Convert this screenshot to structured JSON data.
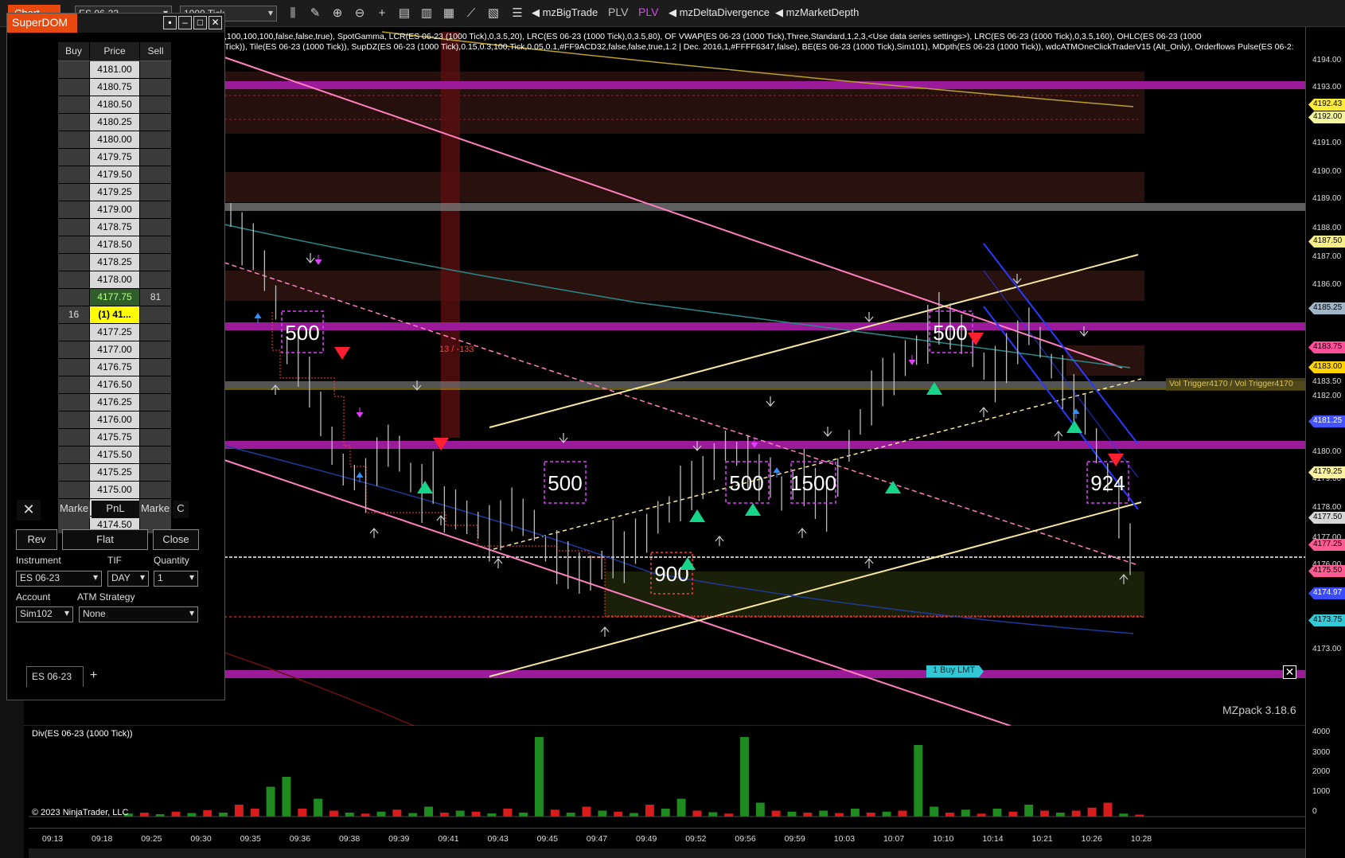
{
  "toolbar": {
    "tab_label": "Chart",
    "instrument": "ES 06-23",
    "interval": "1000 Tick",
    "items": [
      {
        "label": "◀ mzBigTrade"
      },
      {
        "label": "PLV"
      },
      {
        "label": "PLV"
      },
      {
        "label": "◀ mzDeltaDivergence"
      },
      {
        "label": "◀ mzMarketDepth"
      }
    ]
  },
  "chart": {
    "indicator_line1": ",100,100,100,false,false,true), SpotGamma, LCR(ES 06-23 (1000 Tick),0,3.5,20), LRC(ES 06-23 (1000 Tick),0,3.5,80), OF VWAP(ES 06-23 (1000 Tick),Three,Standard,1,2,3,<Use data series settings>), LRC(ES 06-23 (1000 Tick),0,3.5,160), OHLC(ES 06-23 (1000",
    "indicator_line2": "Tick)), Tile(ES 06-23 (1000 Tick)), SupDZ(ES 06-23 (1000 Tick),0.15,0.3,100,Tick,0.05,0.1,#FF9ACD32,false,false,true,1.2 | Dec. 2016,1,#FFFF6347,false), BE(ES 06-23 (1000 Tick),Sim101), MDpth(ES 06-23 (1000 Tick)), wdcATMOneClickTraderV15 (Alt_Only),  Orderflows Pulse(ES 06-2:",
    "vol_trigger": "Vol Trigger4170 / Vol Trigger4170",
    "order_label": "1  Buy LMT",
    "watermark": "MZpack 3.18.6",
    "bigtrade_labels": [
      "500",
      "500",
      "500",
      "500",
      "1500",
      "900",
      "500",
      "924"
    ],
    "delta_label": "13 / -133",
    "div_panel_title": "Div(ES 06-23 (1000 Tick))",
    "copyright": "© 2023 NinjaTrader, LLC"
  },
  "price_axis": {
    "ticks": [
      "4194.00",
      "4193.00",
      "4191.00",
      "4190.00",
      "4189.00",
      "4188.00",
      "4187.00",
      "4186.00",
      "4185.00",
      "4184.00",
      "4183.50",
      "4182.00",
      "4181.00",
      "4180.00",
      "4179.00",
      "4178.00",
      "4177.00",
      "4176.00",
      "4175.00",
      "4174.00",
      "4173.00"
    ],
    "markers": [
      {
        "label": "4192.43",
        "color": "#ffeb3b"
      },
      {
        "label": "4192.00",
        "color": "#f5f5a0"
      },
      {
        "label": "4187.50",
        "color": "#f7f08a"
      },
      {
        "label": "4185.25",
        "color": "#9fb6c9"
      },
      {
        "label": "4183.75",
        "color": "#ff4f9a"
      },
      {
        "label": "4183.00",
        "color": "#ffd400"
      },
      {
        "label": "4181.25",
        "color": "#4455ff"
      },
      {
        "label": "4179.25",
        "color": "#fff2a0"
      },
      {
        "label": "4177.50",
        "color": "#d6d6d6"
      },
      {
        "label": "4177.25",
        "color": "#ff5c93"
      },
      {
        "label": "4175.50",
        "color": "#ff5c93"
      },
      {
        "label": "4174.97",
        "color": "#3b4cff"
      },
      {
        "label": "4173.75",
        "color": "#35c9d8"
      }
    ],
    "volume_ticks": [
      "4000",
      "3000",
      "2000",
      "1000",
      "0"
    ]
  },
  "time_axis": [
    "09:13",
    "09:18",
    "09:25",
    "09:30",
    "09:35",
    "09:36",
    "09:38",
    "09:39",
    "09:41",
    "09:43",
    "09:45",
    "09:47",
    "09:49",
    "09:52",
    "09:56",
    "09:59",
    "10:03",
    "10:07",
    "10:10",
    "10:14",
    "10:21",
    "10:26",
    "10:28"
  ],
  "superdom": {
    "title": "SuperDOM",
    "headers": {
      "buy": "Buy",
      "price": "Price",
      "sell": "Sell"
    },
    "rows": [
      {
        "buy": "",
        "price": "4181.00",
        "sell": ""
      },
      {
        "buy": "",
        "price": "4180.75",
        "sell": ""
      },
      {
        "buy": "",
        "price": "4180.50",
        "sell": ""
      },
      {
        "buy": "",
        "price": "4180.25",
        "sell": ""
      },
      {
        "buy": "",
        "price": "4180.00",
        "sell": ""
      },
      {
        "buy": "",
        "price": "4179.75",
        "sell": ""
      },
      {
        "buy": "",
        "price": "4179.50",
        "sell": ""
      },
      {
        "buy": "",
        "price": "4179.25",
        "sell": ""
      },
      {
        "buy": "",
        "price": "4179.00",
        "sell": ""
      },
      {
        "buy": "",
        "price": "4178.75",
        "sell": ""
      },
      {
        "buy": "",
        "price": "4178.50",
        "sell": ""
      },
      {
        "buy": "",
        "price": "4178.25",
        "sell": ""
      },
      {
        "buy": "",
        "price": "4178.00",
        "sell": ""
      },
      {
        "buy": "",
        "price": "4177.75",
        "sell": "81"
      },
      {
        "buy": "16",
        "price": "(1) 41...",
        "sell": ""
      },
      {
        "buy": "",
        "price": "4177.25",
        "sell": ""
      },
      {
        "buy": "",
        "price": "4177.00",
        "sell": ""
      },
      {
        "buy": "",
        "price": "4176.75",
        "sell": ""
      },
      {
        "buy": "",
        "price": "4176.50",
        "sell": ""
      },
      {
        "buy": "",
        "price": "4176.25",
        "sell": ""
      },
      {
        "buy": "",
        "price": "4176.00",
        "sell": ""
      },
      {
        "buy": "",
        "price": "4175.75",
        "sell": ""
      },
      {
        "buy": "",
        "price": "4175.50",
        "sell": ""
      },
      {
        "buy": "",
        "price": "4175.25",
        "sell": ""
      },
      {
        "buy": "",
        "price": "4175.00",
        "sell": ""
      },
      {
        "buy": "",
        "price": "4174.75",
        "sell": ""
      },
      {
        "buy": "",
        "price": "4174.50",
        "sell": ""
      }
    ],
    "bottom": {
      "close_x": "✕",
      "left": "Marke",
      "mid": "PnL",
      "right": "Marke",
      "c": "C"
    },
    "buttons": {
      "rev": "Rev",
      "flat": "Flat",
      "close": "Close"
    },
    "labels": {
      "instrument": "Instrument",
      "tif": "TIF",
      "quantity": "Quantity",
      "account": "Account",
      "atm": "ATM Strategy"
    },
    "values": {
      "instrument": "ES 06-23",
      "tif": "DAY",
      "quantity": "1",
      "account": "Sim102",
      "atm": "None"
    },
    "tab": "ES 06-23",
    "add_tab": "+"
  },
  "volume_bars": [
    {
      "v": 150,
      "c": "g"
    },
    {
      "v": 200,
      "c": "r"
    },
    {
      "v": 120,
      "c": "g"
    },
    {
      "v": 250,
      "c": "r"
    },
    {
      "v": 180,
      "c": "g"
    },
    {
      "v": 320,
      "c": "r"
    },
    {
      "v": 200,
      "c": "g"
    },
    {
      "v": 600,
      "c": "r"
    },
    {
      "v": 400,
      "c": "r"
    },
    {
      "v": 1500,
      "c": "g"
    },
    {
      "v": 2000,
      "c": "g"
    },
    {
      "v": 400,
      "c": "r"
    },
    {
      "v": 900,
      "c": "g"
    },
    {
      "v": 300,
      "c": "r"
    },
    {
      "v": 200,
      "c": "g"
    },
    {
      "v": 150,
      "c": "r"
    },
    {
      "v": 250,
      "c": "g"
    },
    {
      "v": 350,
      "c": "r"
    },
    {
      "v": 180,
      "c": "g"
    },
    {
      "v": 500,
      "c": "g"
    },
    {
      "v": 200,
      "c": "r"
    },
    {
      "v": 300,
      "c": "g"
    },
    {
      "v": 250,
      "c": "r"
    },
    {
      "v": 160,
      "c": "g"
    },
    {
      "v": 400,
      "c": "r"
    },
    {
      "v": 200,
      "c": "g"
    },
    {
      "v": 4000,
      "c": "g"
    },
    {
      "v": 350,
      "c": "r"
    },
    {
      "v": 200,
      "c": "g"
    },
    {
      "v": 500,
      "c": "r"
    },
    {
      "v": 300,
      "c": "g"
    },
    {
      "v": 250,
      "c": "r"
    },
    {
      "v": 180,
      "c": "g"
    },
    {
      "v": 600,
      "c": "r"
    },
    {
      "v": 400,
      "c": "g"
    },
    {
      "v": 900,
      "c": "g"
    },
    {
      "v": 300,
      "c": "r"
    },
    {
      "v": 220,
      "c": "g"
    },
    {
      "v": 150,
      "c": "r"
    },
    {
      "v": 4100,
      "c": "g"
    },
    {
      "v": 700,
      "c": "g"
    },
    {
      "v": 300,
      "c": "r"
    },
    {
      "v": 250,
      "c": "g"
    },
    {
      "v": 200,
      "c": "r"
    },
    {
      "v": 300,
      "c": "g"
    },
    {
      "v": 180,
      "c": "r"
    },
    {
      "v": 400,
      "c": "g"
    },
    {
      "v": 200,
      "c": "r"
    },
    {
      "v": 250,
      "c": "g"
    },
    {
      "v": 300,
      "c": "r"
    },
    {
      "v": 3600,
      "c": "g"
    },
    {
      "v": 500,
      "c": "g"
    },
    {
      "v": 200,
      "c": "r"
    },
    {
      "v": 350,
      "c": "g"
    },
    {
      "v": 150,
      "c": "r"
    },
    {
      "v": 400,
      "c": "g"
    },
    {
      "v": 250,
      "c": "r"
    },
    {
      "v": 600,
      "c": "g"
    },
    {
      "v": 300,
      "c": "r"
    },
    {
      "v": 200,
      "c": "g"
    },
    {
      "v": 300,
      "c": "r"
    },
    {
      "v": 450,
      "c": "r"
    },
    {
      "v": 700,
      "c": "r"
    },
    {
      "v": 150,
      "c": "g"
    },
    {
      "v": 100,
      "c": "r"
    }
  ]
}
